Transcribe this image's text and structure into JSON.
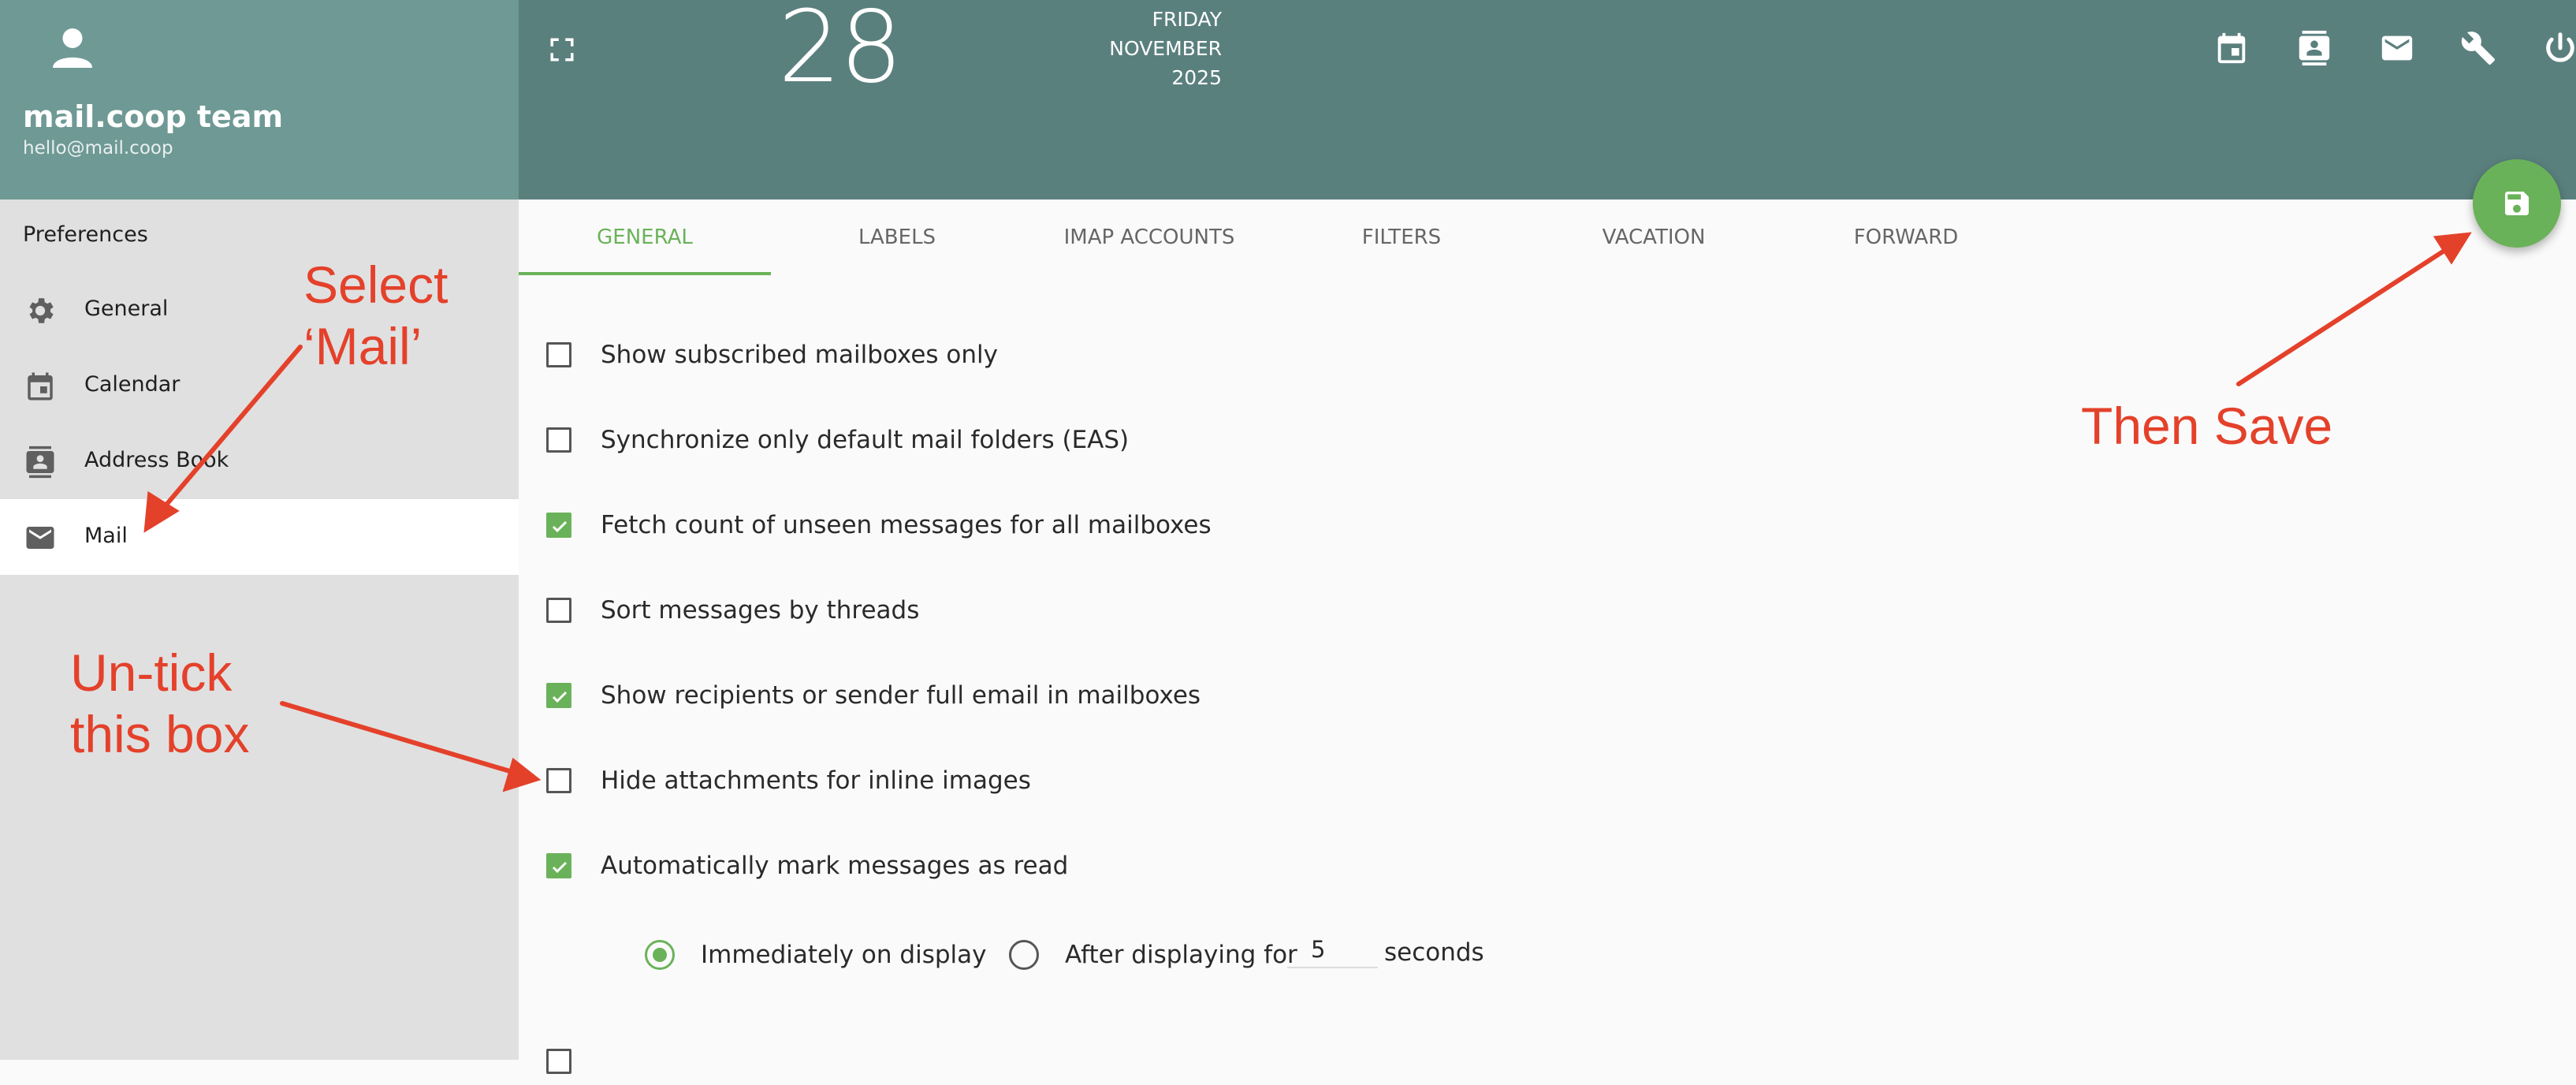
{
  "sidebar": {
    "user_name": "mail.coop team",
    "user_email": "hello@mail.coop",
    "section_heading": "Preferences",
    "items": [
      {
        "label": "General",
        "icon": "gear-icon"
      },
      {
        "label": "Calendar",
        "icon": "calendar-icon"
      },
      {
        "label": "Address Book",
        "icon": "address-book-icon"
      },
      {
        "label": "Mail",
        "icon": "mail-icon",
        "active": true
      }
    ]
  },
  "header": {
    "weekday": "FRIDAY",
    "month": "NOVEMBER",
    "year": "2025",
    "day": "28",
    "icons": [
      "calendar-icon",
      "contacts-icon",
      "mail-icon",
      "wrench-icon",
      "power-icon"
    ]
  },
  "tabs": [
    {
      "label": "GENERAL",
      "active": true
    },
    {
      "label": "LABELS"
    },
    {
      "label": "IMAP ACCOUNTS"
    },
    {
      "label": "FILTERS"
    },
    {
      "label": "VACATION"
    },
    {
      "label": "FORWARD"
    }
  ],
  "options": [
    {
      "label": "Show subscribed mailboxes only",
      "checked": false
    },
    {
      "label": "Synchronize only default mail folders (EAS)",
      "checked": false
    },
    {
      "label": "Fetch count of unseen messages for all mailboxes",
      "checked": true
    },
    {
      "label": "Sort messages by threads",
      "checked": false
    },
    {
      "label": "Show recipients or sender full email in mailboxes",
      "checked": true
    },
    {
      "label": "Hide attachments for inline images",
      "checked": false
    },
    {
      "label": "Automatically mark messages as read",
      "checked": true
    }
  ],
  "mark_read": {
    "immediately_label": "Immediately on display",
    "after_label": "After displaying for",
    "seconds_value": "5",
    "seconds_label": "seconds",
    "selected": "immediately"
  },
  "annotations": {
    "select_mail": "Select\n‘Mail’",
    "untick": "Un-tick\nthis box",
    "then_save": "Then Save",
    "color": "#e4412b"
  },
  "colors": {
    "accent": "#6ab259",
    "sidebar_header": "#6f9994",
    "topbar": "#5a807e"
  }
}
